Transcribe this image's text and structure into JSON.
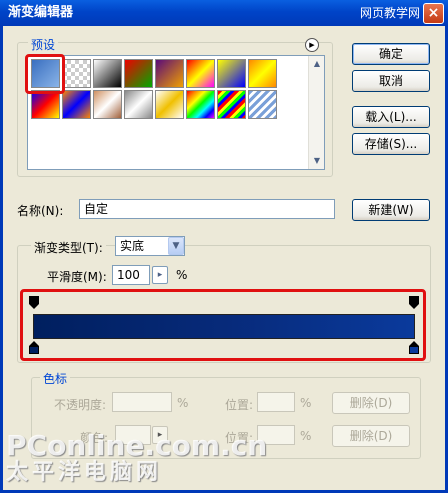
{
  "window": {
    "title": "渐变编辑器",
    "close_glyph": "×"
  },
  "watermark": {
    "top": "网页教学网",
    "brand": "PConline.com.cn",
    "brand_cn": "太平洋电脑网"
  },
  "presets": {
    "legend": "预设",
    "flyout_glyph": "▶"
  },
  "buttons": {
    "ok": "确定",
    "cancel": "取消",
    "load": "载入(L)...",
    "save": "存储(S)...",
    "new": "新建(W)",
    "delete": "删除(D)"
  },
  "name": {
    "label": "名称(N):",
    "value": "自定"
  },
  "gradient_type": {
    "label": "渐变类型(T):",
    "value": "实底"
  },
  "smoothness": {
    "label": "平滑度(M):",
    "value": "100",
    "unit": "%"
  },
  "color_stops": {
    "legend": "色标",
    "opacity_label": "不透明度:",
    "opacity_unit": "%",
    "location_label": "位置:",
    "location_unit": "%",
    "color_label": "颜色:"
  },
  "icons": {
    "dropdown": "▼",
    "scroll_up": "▲",
    "scroll_down": "▼",
    "step": "▸"
  },
  "colors": {
    "stop_left": "#001f5f",
    "stop_right": "#0a3a9c",
    "highlight": "#e01010"
  }
}
